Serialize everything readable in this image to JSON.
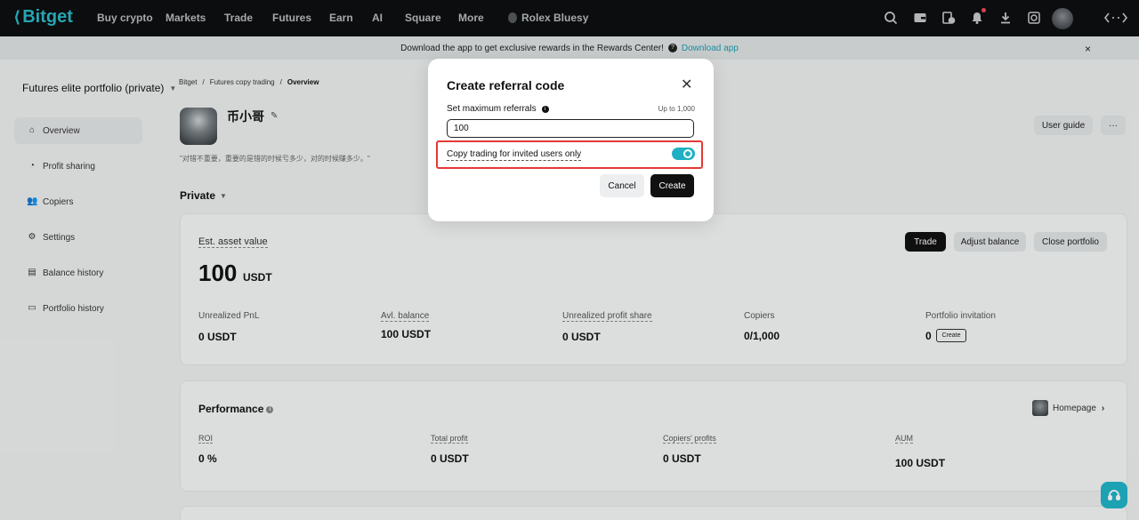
{
  "topnav": {
    "logo": "Bitget",
    "items": [
      "Buy crypto",
      "Markets",
      "Trade",
      "Futures",
      "Earn",
      "AI",
      "Square",
      "More"
    ],
    "username": "Rolex Bluesy",
    "icons": [
      "search-icon",
      "wallet-icon",
      "orders-icon",
      "bell-icon",
      "download-icon",
      "globe-icon",
      "avatar",
      "swap-icon"
    ]
  },
  "banner": {
    "text": "Download the app to get exclusive rewards in the Rewards Center!",
    "link": "Download app",
    "close": "×"
  },
  "sidebar": {
    "portfolio_title": "Futures elite portfolio (private)",
    "items": [
      {
        "label": "Overview",
        "icon": "home-icon"
      },
      {
        "label": "Profit sharing",
        "icon": "profit-icon"
      },
      {
        "label": "Copiers",
        "icon": "users-icon"
      },
      {
        "label": "Settings",
        "icon": "gear-icon"
      },
      {
        "label": "Balance history",
        "icon": "history-icon"
      },
      {
        "label": "Portfolio history",
        "icon": "document-icon"
      }
    ]
  },
  "breadcrumb": [
    "Bitget",
    "Futures copy trading",
    "Overview"
  ],
  "breadcrumb_sep": "/",
  "profile": {
    "name": "币小哥",
    "quote": "\"对错不重要，重要的是错的时候亏多少，对的时候赚多少。\"",
    "user_guide": "User guide",
    "more": "···"
  },
  "private_label": "Private",
  "asset_card": {
    "est_label": "Est. asset value",
    "est_value": "100",
    "est_unit": "USDT",
    "buttons": {
      "trade": "Trade",
      "adjust": "Adjust balance",
      "close": "Close portfolio"
    },
    "stats": [
      {
        "label": "Unrealized PnL",
        "value": "0 USDT"
      },
      {
        "label": "Avl. balance",
        "value": "100 USDT"
      },
      {
        "label": "Unrealized profit share",
        "value": "0 USDT"
      },
      {
        "label": "Copiers",
        "value": "0/1,000"
      },
      {
        "label": "Portfolio invitation",
        "value": "0"
      }
    ],
    "invite_create": "Create"
  },
  "performance": {
    "title": "Performance",
    "homepage": "Homepage",
    "stats": [
      {
        "label": "ROI",
        "value": "0 %"
      },
      {
        "label": "Total profit",
        "value": "0 USDT"
      },
      {
        "label": "Copiers' profits",
        "value": "0 USDT"
      },
      {
        "label": "AUM",
        "value": "100 USDT"
      }
    ]
  },
  "modal": {
    "title": "Create referral code",
    "field_label": "Set maximum referrals",
    "field_hint": "Up to 1,000",
    "field_value": "100",
    "toggle_label": "Copy trading for invited users only",
    "toggle_on": true,
    "cancel": "Cancel",
    "create": "Create"
  },
  "colors": {
    "accent": "#1fb0c4",
    "highlight": "#e53935",
    "nav_bg": "#0d0f10"
  }
}
